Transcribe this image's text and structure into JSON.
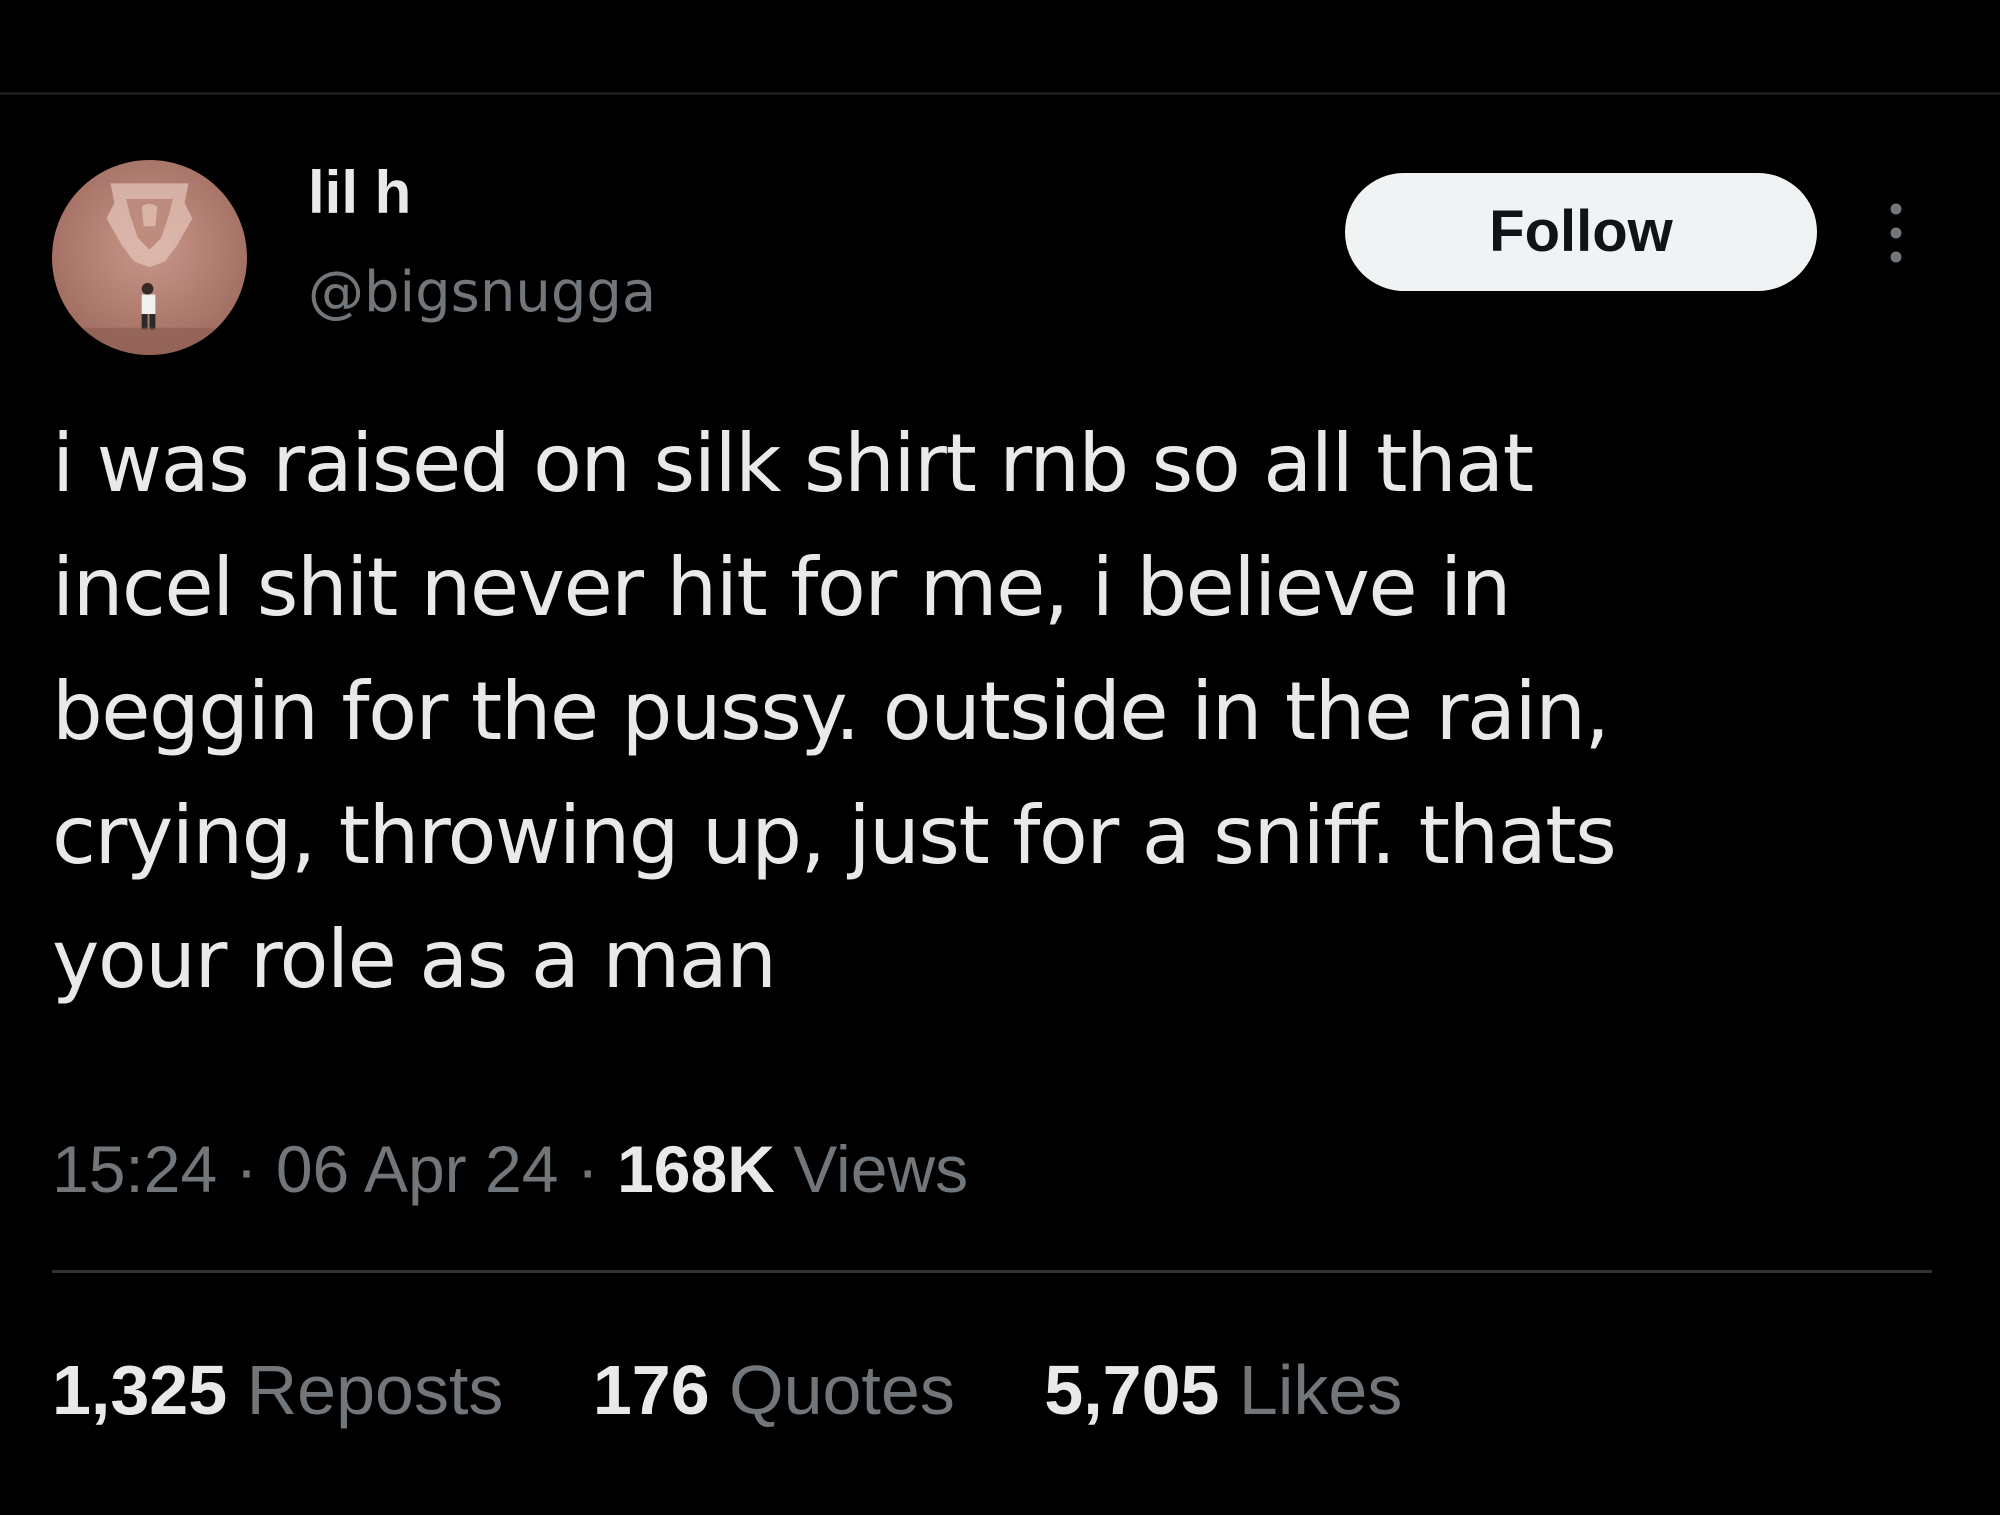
{
  "user": {
    "display_name": "lil h",
    "handle": "@bigsnugga",
    "avatar_icon": "avatar-photo"
  },
  "actions": {
    "follow_label": "Follow",
    "more_icon": "more-vertical-icon"
  },
  "tweet": {
    "lines": [
      "i was raised on silk shirt rnb so all that",
      "incel shit never hit for me, i believe in",
      "beggin for the pussy. outside in the rain,",
      "crying, throwing up, just for a sniff. thats",
      "your role as a man"
    ]
  },
  "meta": {
    "time": "15:24",
    "separator": "·",
    "date": "06 Apr 24",
    "views_count": "168K",
    "views_label": "Views"
  },
  "stats": {
    "reposts_count": "1,325",
    "reposts_label": "Reposts",
    "quotes_count": "176",
    "quotes_label": "Quotes",
    "likes_count": "5,705",
    "likes_label": "Likes"
  },
  "colors": {
    "background": "#000000",
    "text_primary": "#e7e9ea",
    "text_secondary": "#71767b",
    "button_bg": "#eff3f4",
    "divider": "#2f3336"
  }
}
